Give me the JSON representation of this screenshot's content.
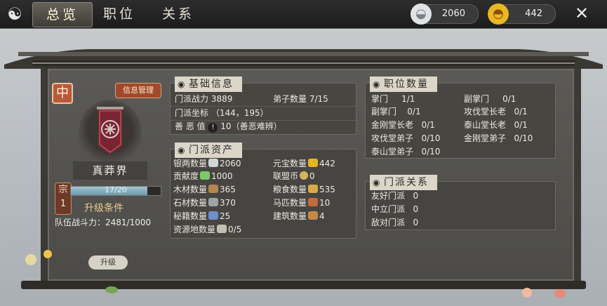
{
  "header": {
    "tabs": [
      {
        "label": "总览",
        "active": true
      },
      {
        "label": "职位",
        "active": false
      },
      {
        "label": "关系",
        "active": false
      }
    ],
    "silver": "2060",
    "ingot": "442"
  },
  "sect": {
    "rank_char": "中",
    "info_button": "信息管理",
    "name": "真莽界",
    "level_label": "宗",
    "level": "1",
    "xp_text": "17/20",
    "xp_fraction": 0.85,
    "upgrade_condition": "升级条件",
    "team_power": "队伍战斗力：2481/1000",
    "upgrade_button": "升级"
  },
  "basic": {
    "title": "基础信息",
    "power_label": "门派战力",
    "power_value": "3889",
    "disciples_label": "弟子数量",
    "disciples_value": "7/15",
    "coords_label": "门派坐标",
    "coords_value": "（144，195）",
    "morality_label": "善 恶 值",
    "morality_value": "10（善恶难辨）"
  },
  "assets": {
    "title": "门派资产",
    "items": [
      {
        "label": "银两数量",
        "value": "2060"
      },
      {
        "label": "元宝数量",
        "value": "442"
      },
      {
        "label": "贡献度",
        "value": "1000"
      },
      {
        "label": "联盟币",
        "value": "0"
      },
      {
        "label": "木材数量",
        "value": "365"
      },
      {
        "label": "粮食数量",
        "value": "535"
      },
      {
        "label": "石材数量",
        "value": "370"
      },
      {
        "label": "马匹数量",
        "value": "10"
      },
      {
        "label": "秘籍数量",
        "value": "25"
      },
      {
        "label": "建筑数量",
        "value": "4"
      },
      {
        "label": "资源地数量",
        "value": "0/5"
      }
    ]
  },
  "positions": {
    "title": "职位数量",
    "items": [
      {
        "label": "掌门",
        "value": "1/1"
      },
      {
        "label": "副掌门",
        "value": "0/1"
      },
      {
        "label": "副掌门",
        "value": "0/1"
      },
      {
        "label": "攻伐堂长老",
        "value": "0/1"
      },
      {
        "label": "金刚堂长老",
        "value": "0/1"
      },
      {
        "label": "泰山堂长老",
        "value": "0/1"
      },
      {
        "label": "攻伐堂弟子",
        "value": "0/10"
      },
      {
        "label": "金刚堂弟子",
        "value": "0/10"
      },
      {
        "label": "泰山堂弟子",
        "value": "0/10"
      }
    ]
  },
  "relations": {
    "title": "门派关系",
    "items": [
      {
        "label": "友好门派",
        "value": "0"
      },
      {
        "label": "中立门派",
        "value": "0"
      },
      {
        "label": "敌对门派",
        "value": "0"
      }
    ]
  }
}
